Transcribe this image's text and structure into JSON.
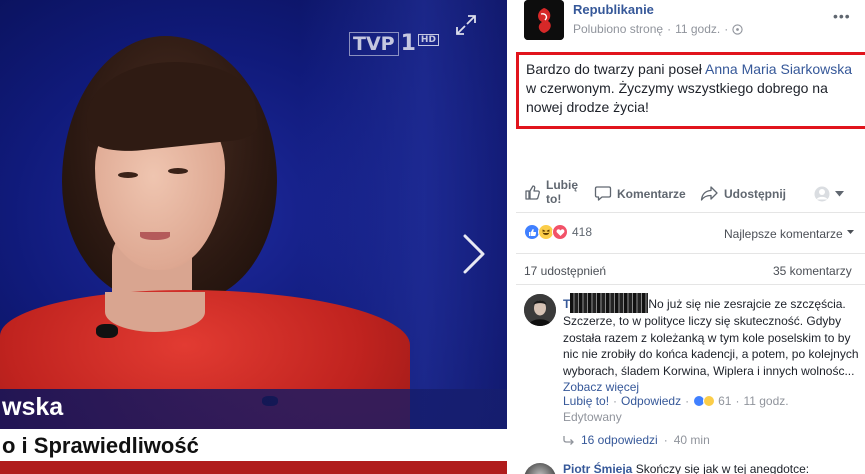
{
  "photo": {
    "channel_logo": {
      "tvp": "TVP",
      "one": "1",
      "hd": "HD"
    },
    "lower_third": {
      "name": "wska",
      "party": "o i Sprawiedliwość"
    }
  },
  "post": {
    "page_name": "Republikanie",
    "liked_label": "Polubiono stronę",
    "time": "11 godz.",
    "text_before": "Bardzo do twarzy pani poseł ",
    "tagged_person": "Anna Maria Siarkowska",
    "text_after": " w czerwonym. Życzymy wszystkiego dobrego na nowej drodze życia!"
  },
  "actions": {
    "like": "Lubię to!",
    "comment": "Komentarze",
    "share": "Udostępnij"
  },
  "stats": {
    "reaction_count": "418",
    "sort_label": "Najlepsze komentarze",
    "shares": "17 udostępnień",
    "comments": "35 komentarzy"
  },
  "comment": {
    "author_visible": "T",
    "text": "No już się nie zesrajcie ze szczęścia. Szczerze, to w polityce liczy się skuteczność. Gdyby została razem z koleżanką w tym kole poselskim to by nic nie zrobiły do końca kadencji, a potem, po kolejnych wyborach, śladem Korwina, Wiplera i innych wolnośc...",
    "see_more": "Zobacz więcej",
    "like": "Lubię to!",
    "reply": "Odpowiedz",
    "reaction_count": "61",
    "time": "11 godz.",
    "edited": "Edytowany",
    "replies": "16 odpowiedzi",
    "replies_time": "40 min"
  },
  "comment2": {
    "author": "Piotr Śmieja",
    "text": "Skończy się jak w tej anegdotce:"
  },
  "colors": {
    "facebook_link": "#365899",
    "highlight_box": "#e1141c",
    "like_blue": "#4080ff",
    "love_red": "#f25268",
    "haha_yellow": "#fbcd49"
  }
}
